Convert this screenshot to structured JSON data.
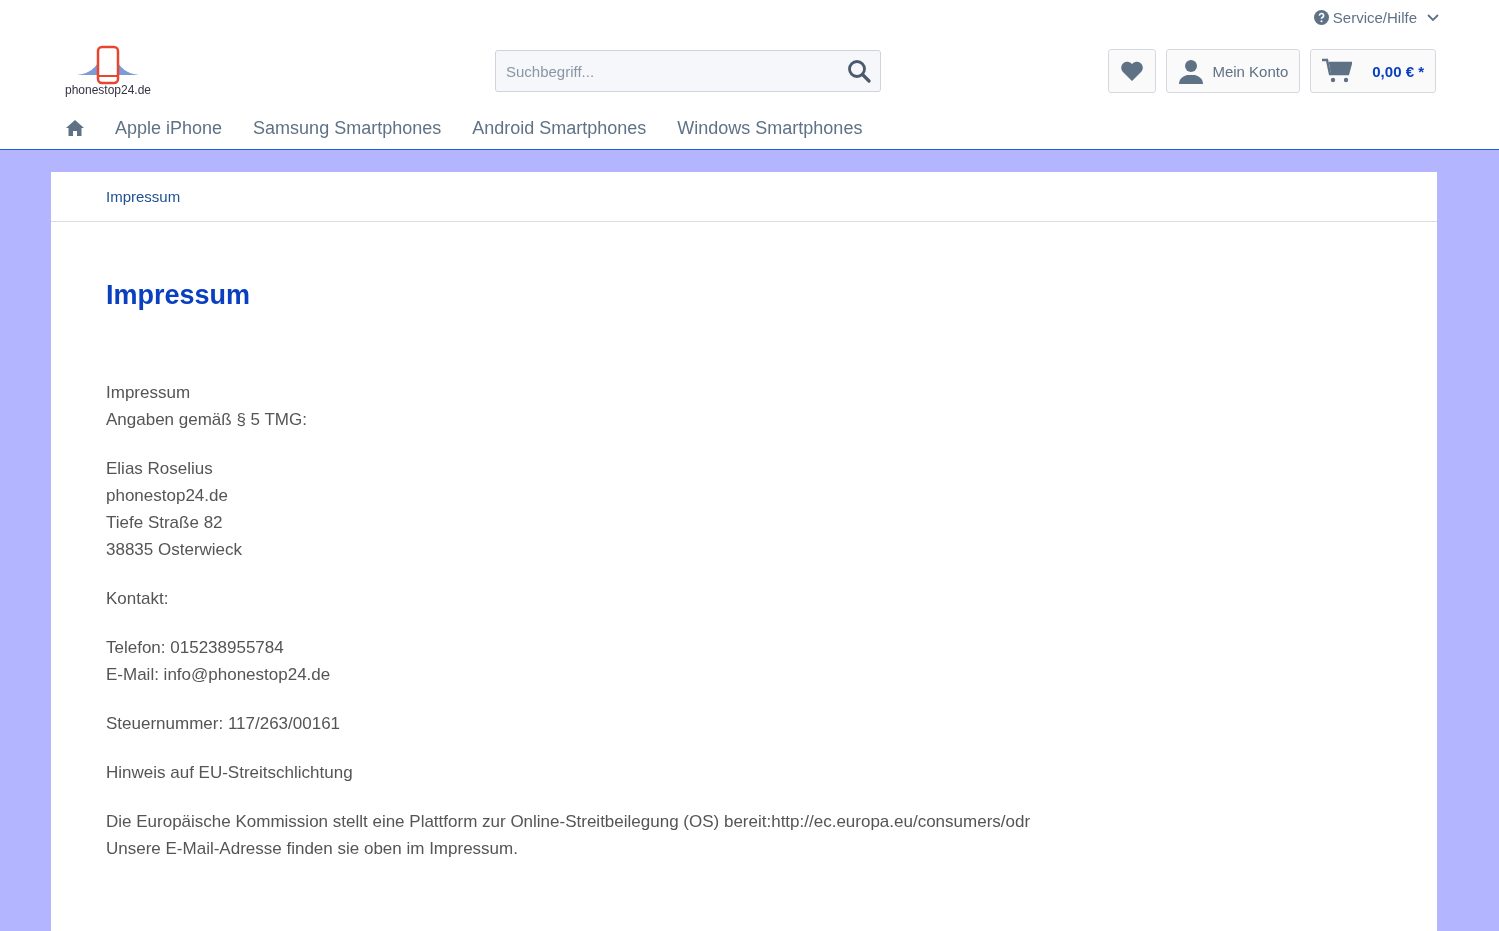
{
  "top_bar": {
    "service_link": "Service/Hilfe"
  },
  "header": {
    "logo_text": "phonestop24.de",
    "search": {
      "placeholder": "Suchbegriff..."
    },
    "account_label": "Mein Konto",
    "cart_total": "0,00 € *"
  },
  "nav": {
    "items": [
      {
        "label": "Apple iPhone"
      },
      {
        "label": "Samsung Smartphones"
      },
      {
        "label": "Android Smartphones"
      },
      {
        "label": "Windows Smartphones"
      }
    ]
  },
  "breadcrumb": "Impressum",
  "title": "Impressum",
  "paragraphs": [
    {
      "lines": [
        "Impressum",
        "Angaben gemäß § 5 TMG:"
      ]
    },
    {
      "lines": [
        "Elias Roselius",
        "phonestop24.de",
        "Tiefe Straße 82",
        "38835 Osterwieck"
      ]
    },
    {
      "lines": [
        "Kontakt:"
      ]
    },
    {
      "lines": [
        "Telefon: 015238955784",
        "E-Mail: info@phonestop24.de"
      ]
    },
    {
      "lines": [
        "Steuernummer: 117/263/00161"
      ]
    },
    {
      "lines": [
        "Hinweis auf EU-Streitschlichtung"
      ]
    },
    {
      "lines": [
        "Die Europäische Kommission stellt eine Plattform zur Online-Streitbeilegung (OS) bereit:http://ec.europa.eu/consumers/odr",
        "Unsere E-Mail-Adresse finden sie oben im Impressum."
      ]
    }
  ]
}
